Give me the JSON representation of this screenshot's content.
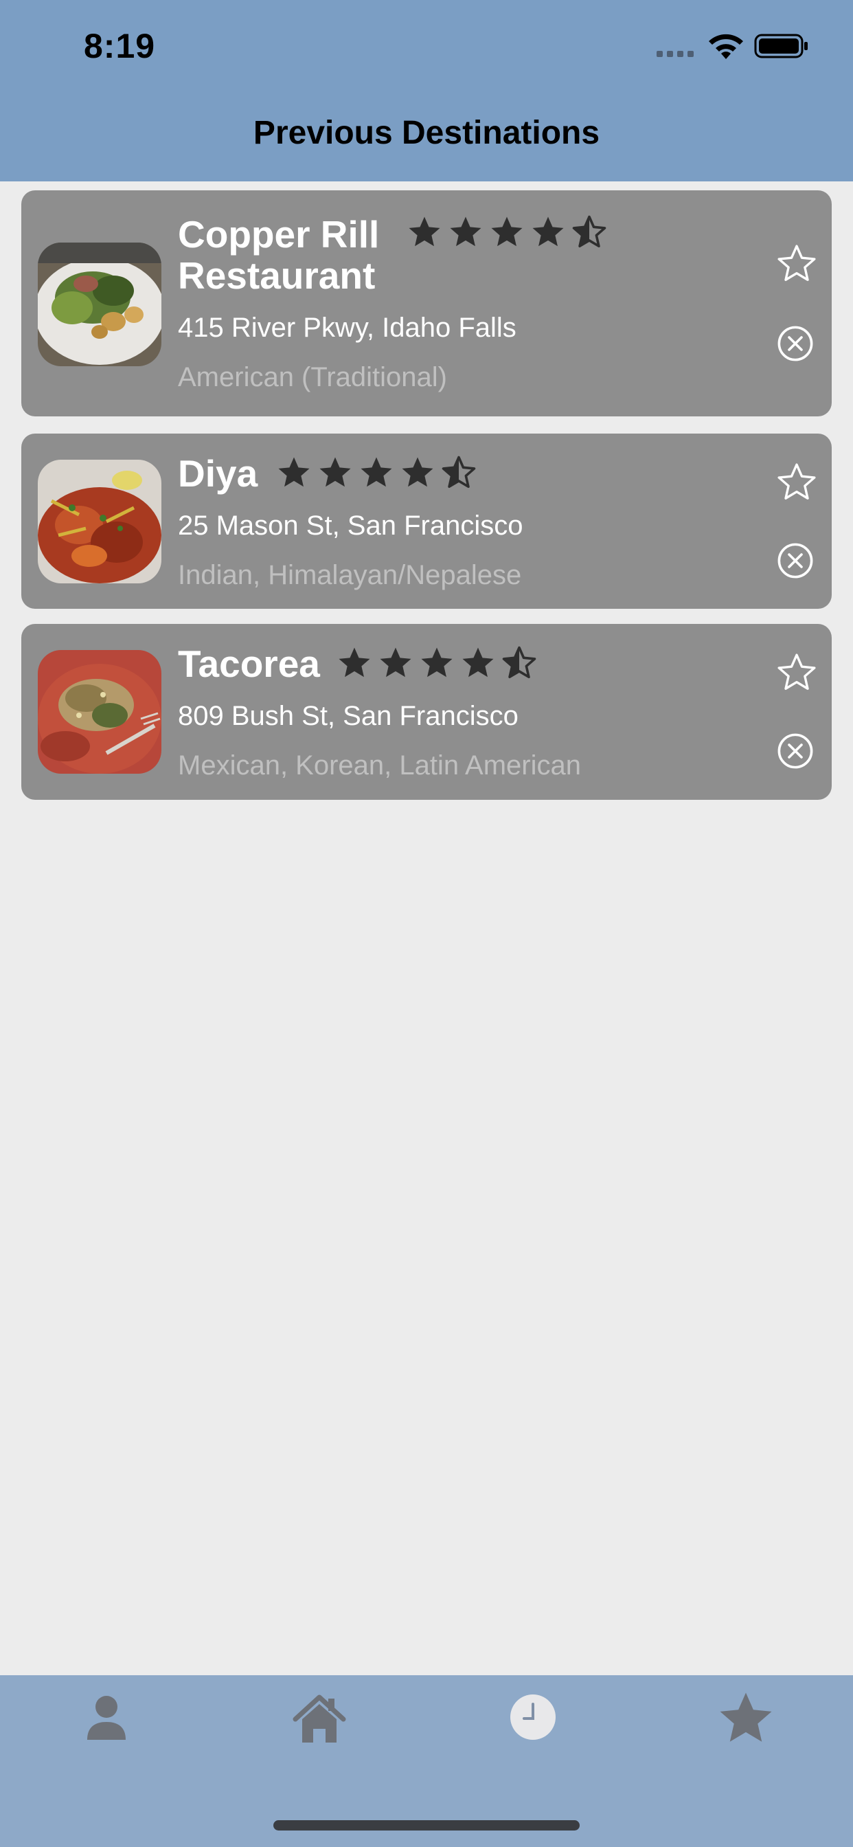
{
  "status_bar": {
    "time": "8:19"
  },
  "header": {
    "title": "Previous Destinations"
  },
  "restaurants": [
    {
      "name": "Copper Rill Restaurant",
      "rating": 4.5,
      "address": "415 River Pkwy, Idaho Falls",
      "cuisine": "American (Traditional)"
    },
    {
      "name": "Diya",
      "rating": 4.5,
      "address": "25 Mason St, San Francisco",
      "cuisine": "Indian, Himalayan/Nepalese"
    },
    {
      "name": "Tacorea",
      "rating": 4.5,
      "address": "809 Bush St, San Francisco",
      "cuisine": "Mexican, Korean, Latin American"
    }
  ],
  "tab_bar": {
    "items": [
      {
        "icon": "person-icon",
        "selected": false
      },
      {
        "icon": "home-icon",
        "selected": false
      },
      {
        "icon": "clock-icon",
        "selected": true
      },
      {
        "icon": "star-icon",
        "selected": false
      }
    ]
  },
  "colors": {
    "header_bg": "#7b9ec4",
    "tab_bar_bg": "#8ea9c8",
    "card_bg": "#8e8e8e",
    "page_bg": "#ececec"
  }
}
